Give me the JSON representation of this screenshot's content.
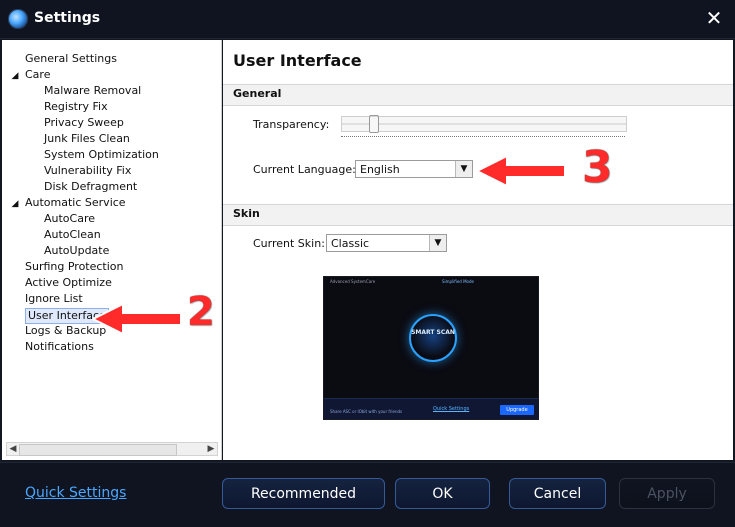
{
  "window": {
    "title": "Settings",
    "close_glyph": "✕"
  },
  "sidebar": {
    "items": [
      {
        "label": "General Settings",
        "indent": 0,
        "expandable": false,
        "selected": false
      },
      {
        "label": "Care",
        "indent": 0,
        "expandable": true,
        "selected": false
      },
      {
        "label": "Malware Removal",
        "indent": 1,
        "expandable": false,
        "selected": false
      },
      {
        "label": "Registry Fix",
        "indent": 1,
        "expandable": false,
        "selected": false
      },
      {
        "label": "Privacy Sweep",
        "indent": 1,
        "expandable": false,
        "selected": false
      },
      {
        "label": "Junk Files Clean",
        "indent": 1,
        "expandable": false,
        "selected": false
      },
      {
        "label": "System Optimization",
        "indent": 1,
        "expandable": false,
        "selected": false
      },
      {
        "label": "Vulnerability Fix",
        "indent": 1,
        "expandable": false,
        "selected": false
      },
      {
        "label": "Disk Defragment",
        "indent": 1,
        "expandable": false,
        "selected": false
      },
      {
        "label": "Automatic Service",
        "indent": 0,
        "expandable": true,
        "selected": false
      },
      {
        "label": "AutoCare",
        "indent": 1,
        "expandable": false,
        "selected": false
      },
      {
        "label": "AutoClean",
        "indent": 1,
        "expandable": false,
        "selected": false
      },
      {
        "label": "AutoUpdate",
        "indent": 1,
        "expandable": false,
        "selected": false
      },
      {
        "label": "Surfing Protection",
        "indent": 0,
        "expandable": false,
        "selected": false
      },
      {
        "label": "Active Optimize",
        "indent": 0,
        "expandable": false,
        "selected": false
      },
      {
        "label": "Ignore List",
        "indent": 0,
        "expandable": false,
        "selected": false
      },
      {
        "label": "User Interface",
        "indent": 0,
        "expandable": false,
        "selected": true
      },
      {
        "label": "Logs & Backup",
        "indent": 0,
        "expandable": false,
        "selected": false
      },
      {
        "label": "Notifications",
        "indent": 0,
        "expandable": false,
        "selected": false
      }
    ]
  },
  "content": {
    "title": "User Interface",
    "general": {
      "label": "General",
      "transparency_label": "Transparency:",
      "transparency_level": 0.1,
      "current_language_label": "Current Language:",
      "current_language_value": "English"
    },
    "skin": {
      "label": "Skin",
      "current_skin_label": "Current Skin:",
      "current_skin_value": "Classic"
    },
    "preview": {
      "title": "Advanced SystemCare",
      "mode": "Simplified Mode",
      "button": "SMART SCAN",
      "share": "Share ASC or IObit with your friends",
      "quick_settings": "Quick Settings",
      "upgrade": "Upgrade"
    }
  },
  "footer": {
    "quick_settings": "Quick Settings",
    "buttons": {
      "recommended": "Recommended",
      "ok": "OK",
      "cancel": "Cancel",
      "apply": "Apply"
    }
  },
  "annotations": {
    "arrow2_number": "2",
    "arrow3_number": "3"
  },
  "colors": {
    "title_bg": "#0f1420",
    "footer_bg": "#0f1420",
    "accent_blue": "#4aa7ff",
    "annotation_red": "#ff2b2b"
  },
  "icons": {
    "close": "close-icon",
    "expander": "triangle-expander-icon",
    "dropdown": "chevron-down-icon",
    "app_logo": "app-logo-icon"
  }
}
